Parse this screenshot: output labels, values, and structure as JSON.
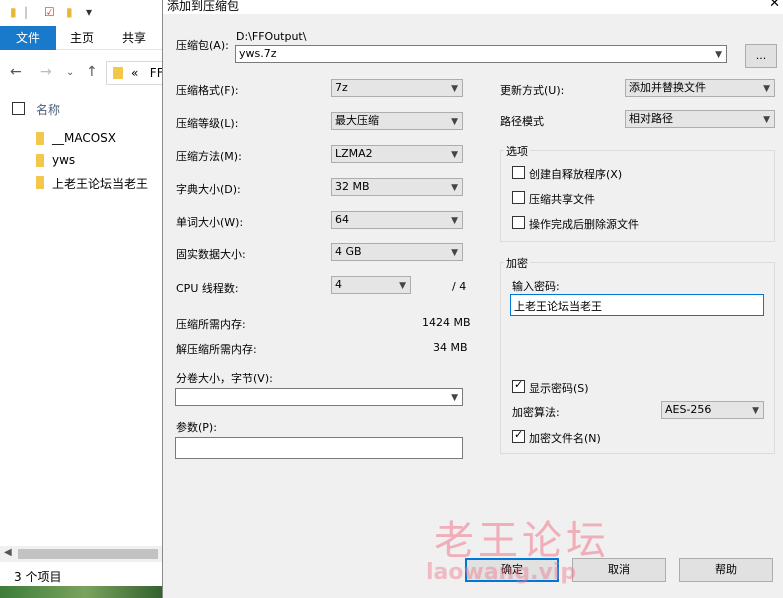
{
  "explorer": {
    "ribbon": {
      "file": "文件",
      "home": "主页",
      "share": "共享"
    },
    "address": {
      "chevrons": "«",
      "path": "FF"
    },
    "column_name": "名称",
    "files": [
      "__MACOSX",
      "yws",
      "上老王论坛当老王"
    ],
    "status": "3 个项目"
  },
  "dialog": {
    "title": "添加到压缩包",
    "close": "✕",
    "archive_label": "压缩包(A):",
    "archive_dir": "D:\\FFOutput\\",
    "archive_name": "yws.7z",
    "browse": "...",
    "format_label": "压缩格式(F):",
    "format_value": "7z",
    "level_label": "压缩等级(L):",
    "level_value": "最大压缩",
    "method_label": "压缩方法(M):",
    "method_value": "LZMA2",
    "dict_label": "字典大小(D):",
    "dict_value": "32 MB",
    "word_label": "单词大小(W):",
    "word_value": "64",
    "solid_label": "固实数据大小:",
    "solid_value": "4 GB",
    "cpu_label": "CPU 线程数:",
    "cpu_value": "4",
    "cpu_total": "/ 4",
    "mem_compress_label": "压缩所需内存:",
    "mem_compress_value": "1424 MB",
    "mem_decompress_label": "解压缩所需内存:",
    "mem_decompress_value": "34 MB",
    "volume_label": "分卷大小，字节(V):",
    "volume_value": "",
    "params_label": "参数(P):",
    "params_value": "",
    "update_label": "更新方式(U):",
    "update_value": "添加并替换文件",
    "path_label": "路径模式",
    "path_value": "相对路径",
    "options_title": "选项",
    "opt_sfx": "创建自释放程序(X)",
    "opt_shared": "压缩共享文件",
    "opt_delete": "操作完成后删除源文件",
    "enc_title": "加密",
    "enc_password_label": "输入密码:",
    "enc_password_value": "上老王论坛当老王",
    "enc_show": "显示密码(S)",
    "enc_method_label": "加密算法:",
    "enc_method_value": "AES-256",
    "enc_names": "加密文件名(N)",
    "ok": "确定",
    "cancel": "取消",
    "help": "帮助"
  },
  "watermark": {
    "cn": "老王论坛",
    "en": "laowang.vip"
  }
}
